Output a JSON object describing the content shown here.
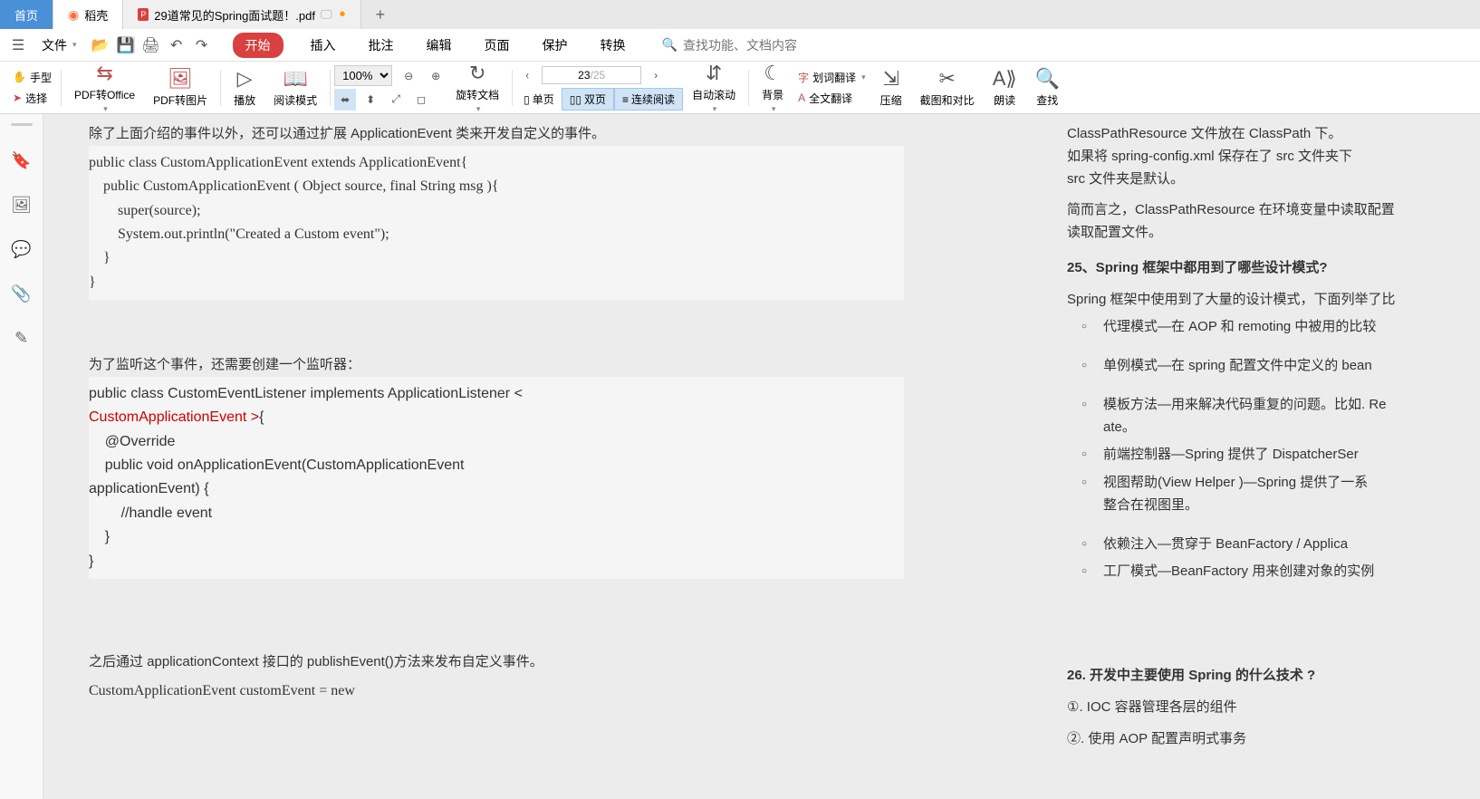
{
  "tabs": {
    "home": "首页",
    "shell": "稻壳",
    "doc": "29道常见的Spring面试题！.pdf"
  },
  "menubar": {
    "file": "文件",
    "menus": [
      "开始",
      "插入",
      "批注",
      "编辑",
      "页面",
      "保护",
      "转换"
    ],
    "search_placeholder": "查找功能、文档内容"
  },
  "toolbar": {
    "hand": "手型",
    "select": "选择",
    "pdf_to_office": "PDF转Office",
    "pdf_to_image": "PDF转图片",
    "play": "播放",
    "read_mode": "阅读模式",
    "zoom": "100%",
    "rotate": "旋转文档",
    "single": "单页",
    "double": "双页",
    "continuous": "连续阅读",
    "page_current": "23",
    "page_total": "/25",
    "auto_scroll": "自动滚动",
    "background": "背景",
    "word_translate": "划词翻译",
    "full_translate": "全文翻译",
    "compress": "压缩",
    "screenshot_compare": "截图和对比",
    "read_aloud": "朗读",
    "search": "查找"
  },
  "content": {
    "left": {
      "intro1": "除了上面介绍的事件以外，还可以通过扩展 ApplicationEvent 类来开发自定义的事件。",
      "code1": "public class CustomApplicationEvent extends ApplicationEvent{\n    public CustomApplicationEvent ( Object source, final String msg ){\n        super(source);\n        System.out.println(\"Created a Custom event\");\n    }\n}",
      "intro2": "为了监听这个事件，还需要创建一个监听器：",
      "code2a": "public class CustomEventListener implements ApplicationListener <",
      "code2b": "CustomApplicationEvent >",
      "code2c": "{\n    @Override\n    public void onApplicationEvent(CustomApplicationEvent\napplicationEvent) {\n        //handle event\n    }\n}",
      "intro3": "之后通过 applicationContext 接口的 publishEvent()方法来发布自定义事件。",
      "code3": "CustomApplicationEvent customEvent = new"
    },
    "right": {
      "p1": "ClassPathResource 文件放在 ClassPath 下。",
      "p2": "如果将 spring-config.xml 保存在了 src 文件夹下",
      "p3": "src 文件夹是默认。",
      "p4": "简而言之，ClassPathResource 在环境变量中读取配置",
      "p5": "读取配置文件。",
      "h25": "25、Spring 框架中都用到了哪些设计模式?",
      "p6": "Spring 框架中使用到了大量的设计模式，下面列举了比",
      "b1": "代理模式—在 AOP 和 remoting 中被用的比较",
      "b2": "单例模式—在 spring 配置文件中定义的 bean ",
      "b3": "模板方法—用来解决代码重复的问题。比如. Re",
      "b3a": "ate。",
      "b4": "前端控制器—Spring 提供了 DispatcherSer",
      "b5": "视图帮助(View Helper )—Spring 提供了一系",
      "b5a": "整合在视图里。",
      "b6": "依赖注入—贯穿于 BeanFactory / Applica",
      "b7": "工厂模式—BeanFactory 用来创建对象的实例",
      "h26": "26. 开发中主要使用 Spring 的什么技术 ?",
      "p7": "①. IOC 容器管理各层的组件",
      "p8": "②. 使用 AOP 配置声明式事务"
    }
  }
}
